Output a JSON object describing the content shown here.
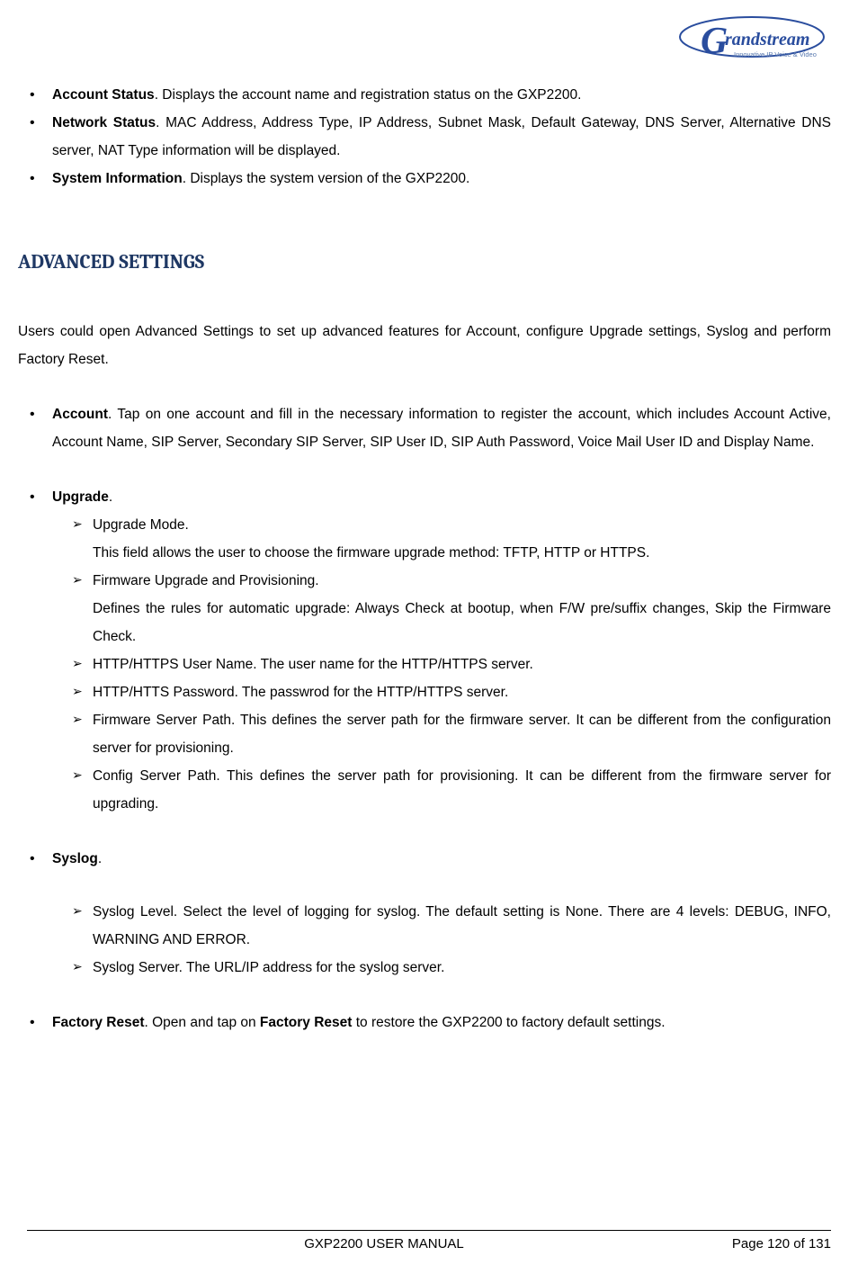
{
  "logo": {
    "brand_letter": "G",
    "brand_text": "randstream",
    "tagline": "Innovative IP Voice & Video"
  },
  "topList": [
    {
      "bold": "Account Status",
      "rest": ". Displays the account name and registration status on the GXP2200."
    },
    {
      "bold": "Network Status",
      "rest": ". MAC Address, Address Type, IP Address, Subnet Mask, Default Gateway, DNS Server, Alternative DNS server, NAT Type information will be displayed."
    },
    {
      "bold": "System Information",
      "rest": ". Displays the system version of the GXP2200."
    }
  ],
  "heading": "ADVANCED SETTINGS",
  "intro": "Users could open Advanced Settings to set up advanced features for Account, configure Upgrade settings, Syslog and perform Factory Reset.",
  "account": {
    "bold": "Account",
    "rest": ". Tap on one account and fill in the necessary information to register the account, which includes Account Active, Account Name, SIP Server, Secondary SIP Server, SIP User ID, SIP Auth Password, Voice Mail User ID and Display Name."
  },
  "upgrade": {
    "bold": "Upgrade",
    "rest": ".",
    "items": [
      {
        "title": "Upgrade Mode.",
        "desc": "This field allows the user to choose the firmware upgrade method: TFTP, HTTP or HTTPS."
      },
      {
        "title": "Firmware Upgrade and Provisioning.",
        "desc": "Defines the rules for automatic upgrade: Always Check at bootup, when F/W pre/suffix changes, Skip the Firmware Check."
      },
      {
        "title": "HTTP/HTTPS User Name. The user name for the HTTP/HTTPS server.",
        "desc": ""
      },
      {
        "title": "HTTP/HTTS Password. The passwrod for the HTTP/HTTPS server.",
        "desc": ""
      },
      {
        "title": "Firmware Server Path. This defines the server path for the firmware server. It can be different from the configuration server for provisioning.",
        "desc": ""
      },
      {
        "title": "Config Server Path. This defines the server path for provisioning. It can be different from the firmware server for upgrading.",
        "desc": ""
      }
    ]
  },
  "syslog": {
    "bold": "Syslog",
    "rest": ".",
    "items": [
      {
        "title": "Syslog Level. Select the level of logging for syslog. The default setting is None. There are 4 levels: DEBUG, INFO, WARNING AND ERROR."
      },
      {
        "title": "Syslog Server. The URL/IP address for the syslog server."
      }
    ]
  },
  "factoryReset": {
    "bold1": "Factory Reset",
    "mid": ". Open and tap on ",
    "bold2": "Factory Reset",
    "rest": " to restore the GXP2200 to factory default settings."
  },
  "footer": {
    "left": "GXP2200 USER MANUAL",
    "right": "Page 120 of 131"
  }
}
